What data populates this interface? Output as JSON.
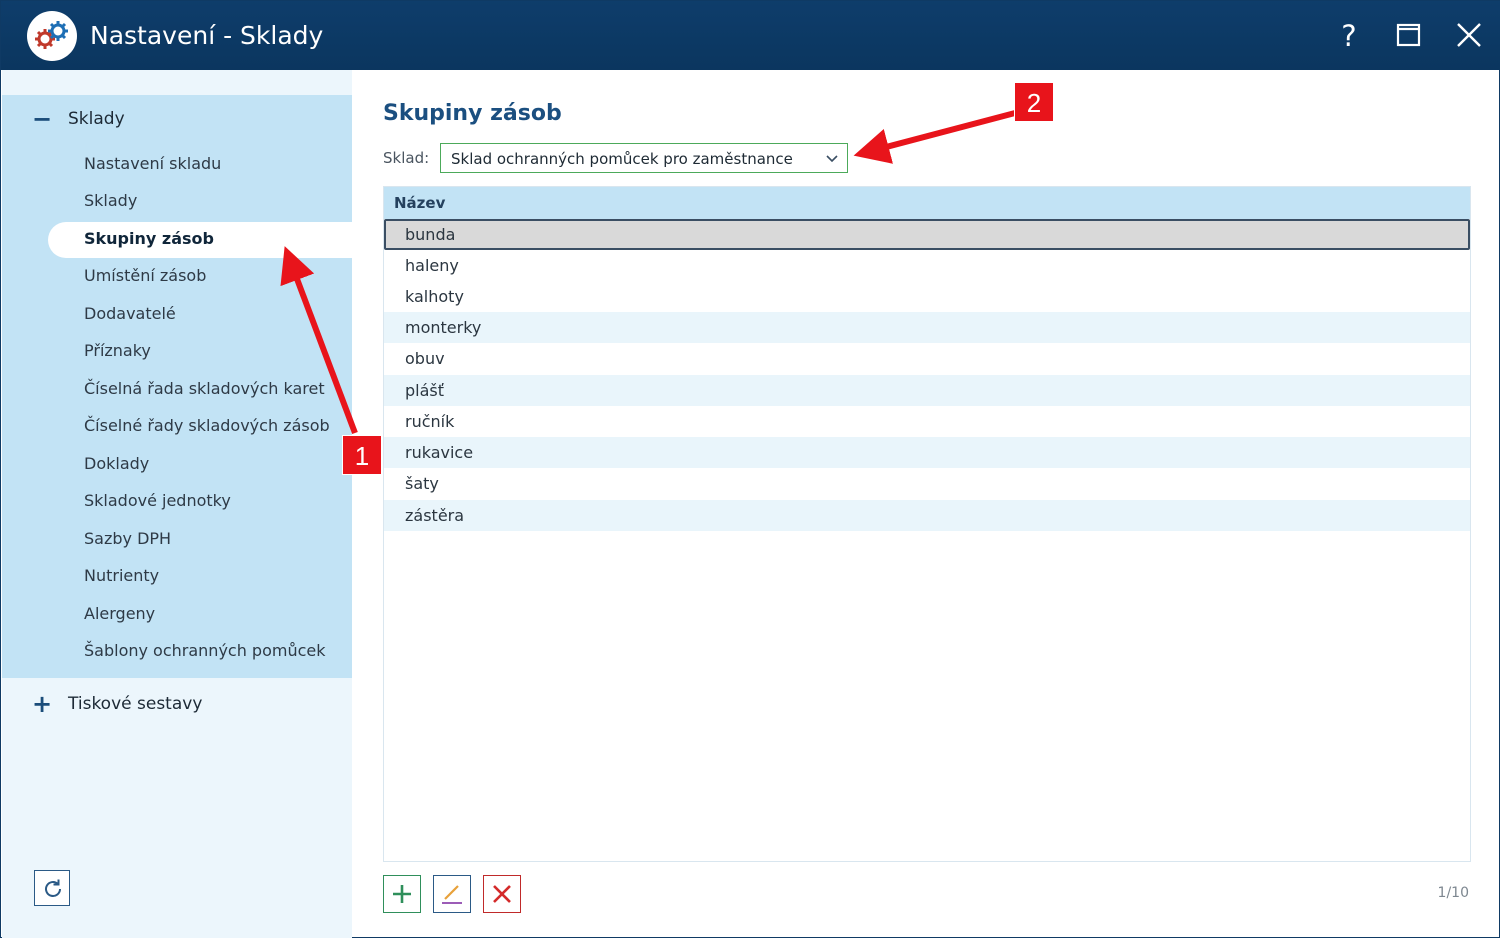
{
  "window": {
    "title": "Nastavení - Sklady",
    "help_label": "?"
  },
  "sidebar": {
    "groups": [
      {
        "sign": "−",
        "label": "Sklady",
        "items": [
          {
            "label": "Nastavení skladu"
          },
          {
            "label": "Sklady"
          },
          {
            "label": "Skupiny zásob",
            "active": true
          },
          {
            "label": "Umístění zásob"
          },
          {
            "label": "Dodavatelé"
          },
          {
            "label": "Příznaky"
          },
          {
            "label": "Číselná řada skladových karet"
          },
          {
            "label": "Číselné řady skladových zásob"
          },
          {
            "label": "Doklady"
          },
          {
            "label": "Skladové jednotky"
          },
          {
            "label": "Sazby DPH"
          },
          {
            "label": "Nutrienty"
          },
          {
            "label": "Alergeny"
          },
          {
            "label": "Šablony ochranných pomůcek"
          }
        ]
      },
      {
        "sign": "+",
        "label": "Tiskové sestavy",
        "items": []
      }
    ]
  },
  "main": {
    "title": "Skupiny zásob",
    "sklad_label": "Sklad:",
    "sklad_value": "Sklad ochranných pomůcek pro zaměstnance",
    "column_header": "Název",
    "rows": [
      "bunda",
      "haleny",
      "kalhoty",
      "monterky",
      "obuv",
      "plášť",
      "ručník",
      "rukavice",
      "šaty",
      "zástěra"
    ],
    "selected_row": 0,
    "pager": "1/10"
  },
  "annotations": {
    "callout_1": "1",
    "callout_2": "2"
  },
  "colors": {
    "titlebar": "#0e3d6b",
    "nav_background": "#c2e3f5",
    "accent_title": "#1b4f80",
    "add": "#2f8f5b",
    "delete": "#c02a2a",
    "callout": "#e8141b"
  }
}
